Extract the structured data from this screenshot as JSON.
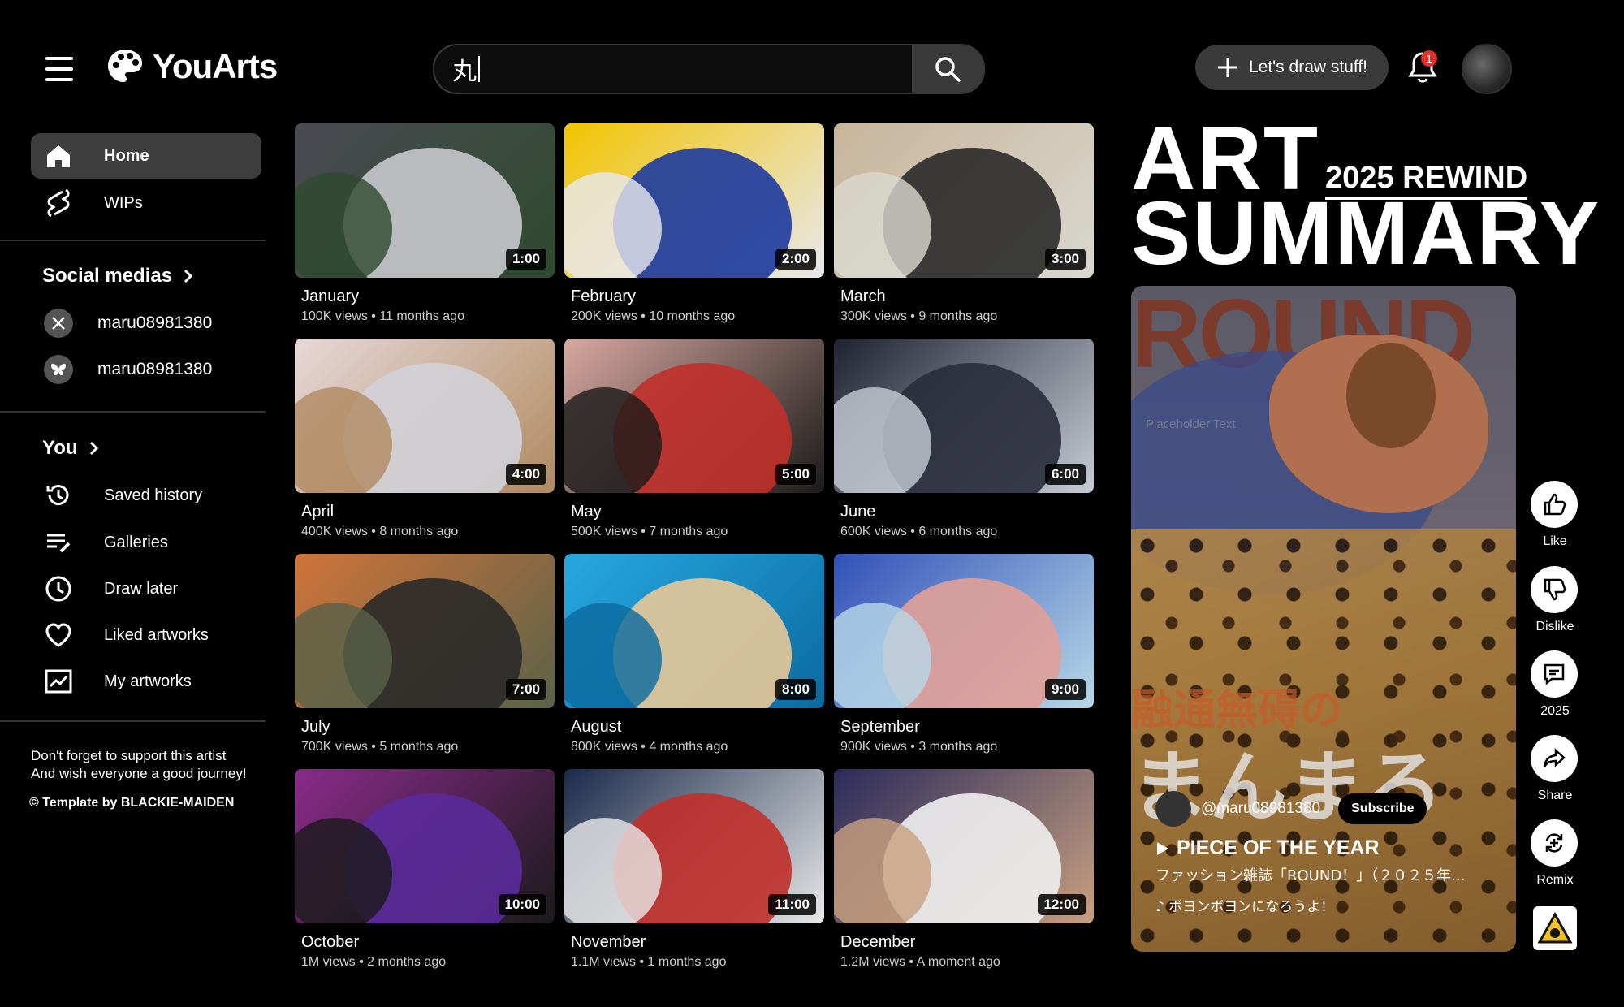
{
  "app": {
    "name": "YouArts"
  },
  "header": {
    "search_value": "丸",
    "create_label": "Let's draw stuff!",
    "notification_count": "1"
  },
  "sidebar": {
    "main": [
      {
        "label": "Home",
        "icon": "home-icon",
        "active": true
      },
      {
        "label": "WIPs",
        "icon": "shorts-icon",
        "active": false
      }
    ],
    "social_title": "Social medias",
    "socials": [
      {
        "label": "maru08981380",
        "icon": "x-icon"
      },
      {
        "label": "maru08981380",
        "icon": "butterfly-icon"
      }
    ],
    "you_title": "You",
    "you_items": [
      {
        "label": "Saved history",
        "icon": "history-icon"
      },
      {
        "label": "Galleries",
        "icon": "playlist-icon"
      },
      {
        "label": "Draw later",
        "icon": "clock-icon"
      },
      {
        "label": "Liked artworks",
        "icon": "heart-icon"
      },
      {
        "label": "My artworks",
        "icon": "chart-icon"
      }
    ],
    "footnote_line1": "Don't forget to support this artist",
    "footnote_line2": "And wish everyone a good journey!",
    "credit": "© Template by BLACKIE-MAIDEN"
  },
  "videos": [
    {
      "title": "January",
      "meta": "100K views • 11 months ago",
      "duration": "1:00",
      "colors": [
        "#4a4a52",
        "#c8c8cc",
        "#2e4a2e"
      ]
    },
    {
      "title": "February",
      "meta": "200K views • 10 months ago",
      "duration": "2:00",
      "colors": [
        "#f2c400",
        "#1d3aa0",
        "#e8e8ee"
      ]
    },
    {
      "title": "March",
      "meta": "300K views • 9 months ago",
      "duration": "3:00",
      "colors": [
        "#c8b49a",
        "#2a2a2a",
        "#d9d9d0"
      ]
    },
    {
      "title": "April",
      "meta": "400K views • 8 months ago",
      "duration": "4:00",
      "colors": [
        "#e7d8d8",
        "#d2d2d8",
        "#b08a60"
      ]
    },
    {
      "title": "May",
      "meta": "500K views • 7 months ago",
      "duration": "5:00",
      "colors": [
        "#d8a8a0",
        "#c0302a",
        "#1a1a1a"
      ]
    },
    {
      "title": "June",
      "meta": "600K views • 6 months ago",
      "duration": "6:00",
      "colors": [
        "#1e2230",
        "#2a2e3a",
        "#c8ccd6"
      ]
    },
    {
      "title": "July",
      "meta": "700K views • 5 months ago",
      "duration": "7:00",
      "colors": [
        "#d0743a",
        "#2a2a2a",
        "#5a6248"
      ]
    },
    {
      "title": "August",
      "meta": "800K views • 4 months ago",
      "duration": "8:00",
      "colors": [
        "#28a8e0",
        "#e8c898",
        "#0a6aa0"
      ]
    },
    {
      "title": "September",
      "meta": "900K views • 3 months ago",
      "duration": "9:00",
      "colors": [
        "#3050b8",
        "#e0a098",
        "#b8d8e8"
      ]
    },
    {
      "title": "October",
      "meta": "1M views • 2 months ago",
      "duration": "10:00",
      "colors": [
        "#8a2a8a",
        "#5a2a9a",
        "#1a1a1a"
      ]
    },
    {
      "title": "November",
      "meta": "1.1M views • 1 months ago",
      "duration": "11:00",
      "colors": [
        "#1a2a4a",
        "#c0302a",
        "#e8e8e8"
      ]
    },
    {
      "title": "December",
      "meta": "1.2M views • A moment ago",
      "duration": "12:00",
      "colors": [
        "#2a2a5a",
        "#f0f0f0",
        "#c8a080"
      ]
    }
  ],
  "summary": {
    "title_line1": "ART",
    "title_line2": "SUMMARY",
    "rewind": "2025 REWIND",
    "poster_word": "ROUND",
    "placeholder": "Placeholder Text",
    "jp_orange": "融通無碍の",
    "jp_big": "まんまる",
    "channel": "@maru08981380",
    "subscribe": "Subscribe",
    "headline": "PIECE OF THE YEAR",
    "description": "ファッション雑誌「ROUND！」（２０２５年...",
    "song": "ボヨンボヨンになろうよ！"
  },
  "actions": [
    {
      "label": "Like",
      "icon": "thumb-up-icon"
    },
    {
      "label": "Dislike",
      "icon": "thumb-down-icon"
    },
    {
      "label": "2025",
      "icon": "comment-icon"
    },
    {
      "label": "Share",
      "icon": "share-icon"
    },
    {
      "label": "Remix",
      "icon": "remix-icon"
    }
  ]
}
